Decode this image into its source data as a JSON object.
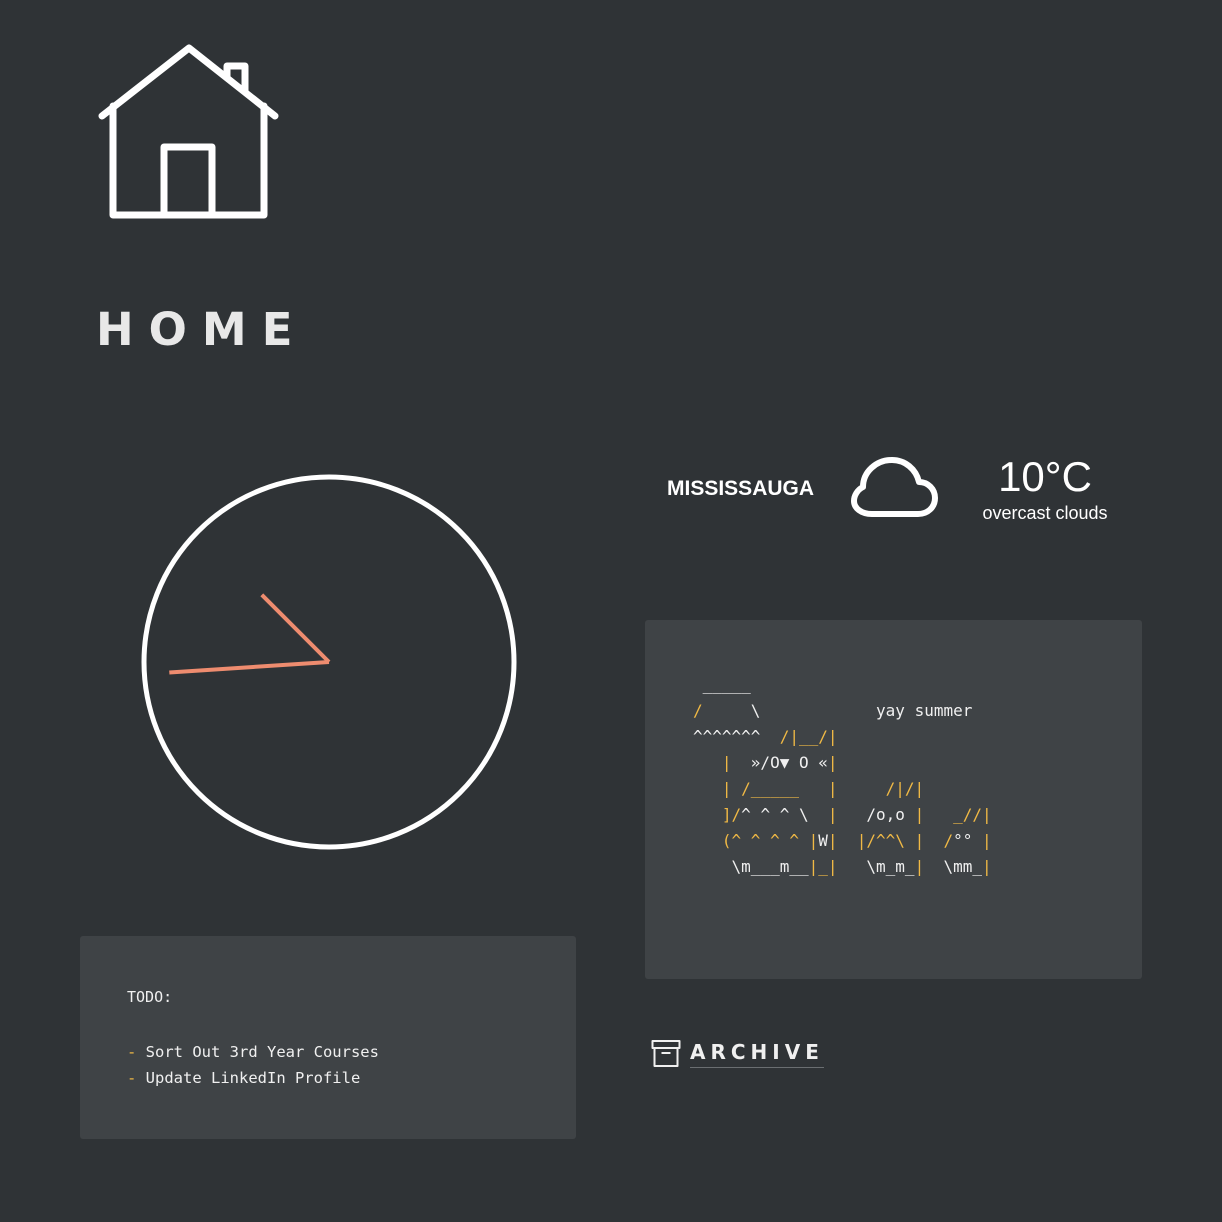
{
  "page": {
    "title": "HOME",
    "icon": "house-icon"
  },
  "clock": {
    "hand_color": "#ee8c6f",
    "face_color": "#ffffff",
    "hour": 8,
    "minute": 52.5
  },
  "weather": {
    "city": "MISSISSAUGA",
    "icon": "cloud-icon",
    "temperature": "10°C",
    "description": "overcast clouds"
  },
  "ascii_art": {
    "caption": "yay summer",
    "accent_color": "#f0b945",
    "lines": [
      [
        [
          "w",
          " _____"
        ]
      ],
      [
        [
          "y",
          "/"
        ],
        [
          "w",
          "     \\"
        ],
        [
          "w",
          "            yay summer"
        ]
      ],
      [
        [
          "w",
          "^^^^^^^  "
        ],
        [
          "y",
          "/|__/|"
        ]
      ],
      [
        [
          "y",
          "   |  "
        ],
        [
          "w",
          "»/O▼ O «"
        ],
        [
          "y",
          "|"
        ]
      ],
      [
        [
          "y",
          "   | /_____   |     /|/|"
        ]
      ],
      [
        [
          "y",
          "   ]/"
        ],
        [
          "w",
          "^ ^ ^ \\"
        ],
        [
          "y",
          "  |   "
        ],
        [
          "w",
          "/o,o"
        ],
        [
          "y",
          " |   _//|"
        ]
      ],
      [
        [
          "y",
          "   (^ ^ ^ ^ |"
        ],
        [
          "w",
          "W"
        ],
        [
          "y",
          "|  |/^^\\ |  /"
        ],
        [
          "w",
          "°°"
        ],
        [
          "y",
          " |"
        ]
      ],
      [
        [
          "w",
          "    \\m___m__"
        ],
        [
          "y",
          "|_|"
        ],
        [
          "w",
          "   \\m_m_"
        ],
        [
          "y",
          "|"
        ],
        [
          "w",
          "  \\mm_"
        ],
        [
          "y",
          "|"
        ]
      ]
    ]
  },
  "todo": {
    "title": "TODO:",
    "items": [
      {
        "dash": "- ",
        "text": "Sort Out 3rd Year Courses"
      },
      {
        "dash": "- ",
        "text": "Update LinkedIn Profile"
      }
    ]
  },
  "archive": {
    "label": "ARCHIVE",
    "icon": "archive-box-icon"
  }
}
